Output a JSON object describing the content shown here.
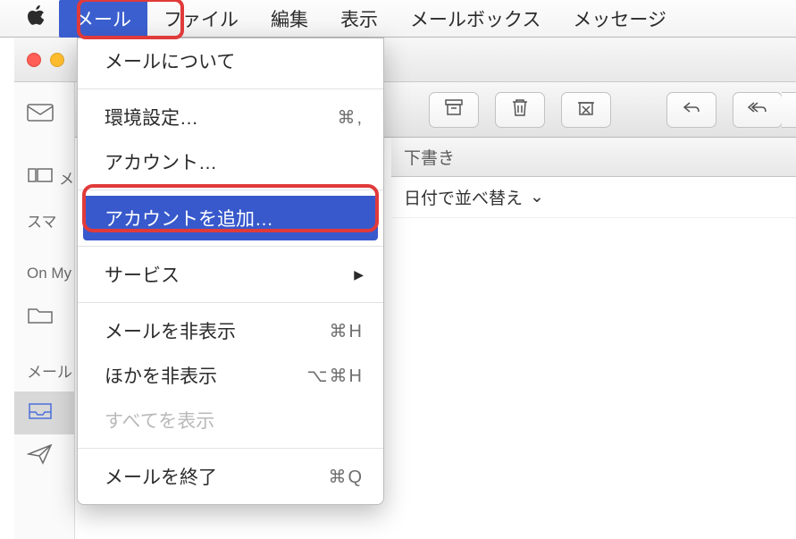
{
  "menubar": {
    "apple": "",
    "items": [
      "メール",
      "ファイル",
      "編集",
      "表示",
      "メールボックス",
      "メッセージ"
    ],
    "active_index": 0
  },
  "dropdown": {
    "items": [
      {
        "label": "メールについて",
        "shortcut": "",
        "type": "item"
      },
      {
        "type": "sep"
      },
      {
        "label": "環境設定…",
        "shortcut": "⌘,",
        "type": "item"
      },
      {
        "label": "アカウント…",
        "shortcut": "",
        "type": "item"
      },
      {
        "type": "sep"
      },
      {
        "label": "アカウントを追加…",
        "shortcut": "",
        "type": "item",
        "highlight": true
      },
      {
        "type": "sep"
      },
      {
        "label": "サービス",
        "shortcut": "",
        "type": "submenu"
      },
      {
        "type": "sep"
      },
      {
        "label": "メールを非表示",
        "shortcut": "⌘H",
        "type": "item"
      },
      {
        "label": "ほかを非表示",
        "shortcut": "⌥⌘H",
        "type": "item"
      },
      {
        "label": "すべてを表示",
        "shortcut": "",
        "type": "item",
        "disabled": true
      },
      {
        "type": "sep"
      },
      {
        "label": "メールを終了",
        "shortcut": "⌘Q",
        "type": "item"
      }
    ]
  },
  "sidebar": {
    "group1_label": "メ",
    "group2_label": "スマ",
    "group3_label": "On My",
    "group4_label": "メール"
  },
  "listhdr": {
    "label": "下書き"
  },
  "sortbar": {
    "label": "日付で並べ替え",
    "chev": "⌄"
  }
}
